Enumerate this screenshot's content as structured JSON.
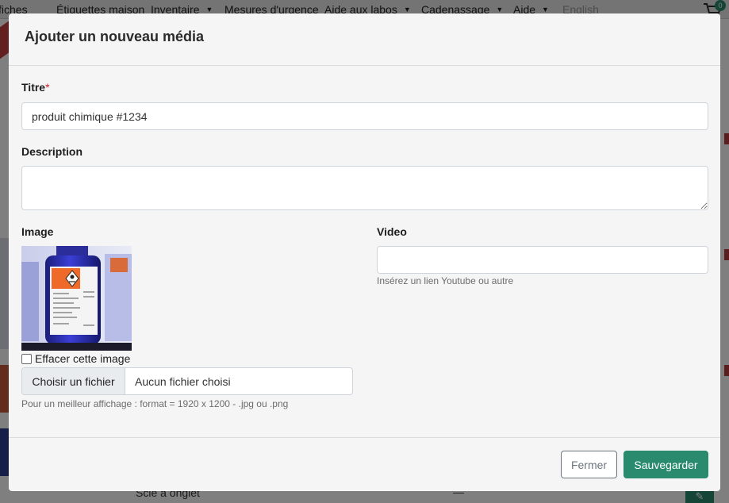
{
  "background": {
    "nav_items": [
      {
        "label": "fiches",
        "caret": false,
        "muted": false
      },
      {
        "label": "Étiquettes maison",
        "caret": false,
        "muted": false
      },
      {
        "label": "Inventaire",
        "caret": true,
        "muted": false
      },
      {
        "label": "Mesures d'urgence",
        "caret": false,
        "muted": false
      },
      {
        "label": "Aide aux labos",
        "caret": true,
        "muted": false
      },
      {
        "label": "Cadenassage",
        "caret": true,
        "muted": false
      },
      {
        "label": "Aide",
        "caret": true,
        "muted": false
      },
      {
        "label": "English",
        "caret": false,
        "muted": true
      }
    ],
    "cart_count": "0",
    "row_text": "Scie à onglet",
    "row_dash": "—",
    "edit_icon": "pencil-icon"
  },
  "modal": {
    "title": "Ajouter un nouveau média",
    "title_field": {
      "label": "Titre",
      "required_mark": "*",
      "value": "produit chimique #1234"
    },
    "description_field": {
      "label": "Description",
      "value": ""
    },
    "image_field": {
      "label": "Image",
      "preview_alt": "bottle-with-hazard-labels",
      "clear_label": "Effacer cette image",
      "clear_checked": false,
      "choose_button": "Choisir un fichier",
      "no_file_text": "Aucun fichier choisi",
      "help": "Pour un meilleur affichage : format = 1920 x 1200 - .jpg ou .png"
    },
    "video_field": {
      "label": "Video",
      "value": "",
      "help": "Insérez un lien Youtube ou autre"
    },
    "buttons": {
      "close": "Fermer",
      "save": "Sauvegarder"
    }
  },
  "colors": {
    "accent": "#2a8a6d",
    "required": "#d0202a",
    "modal_bg": "#f5f5f5"
  }
}
